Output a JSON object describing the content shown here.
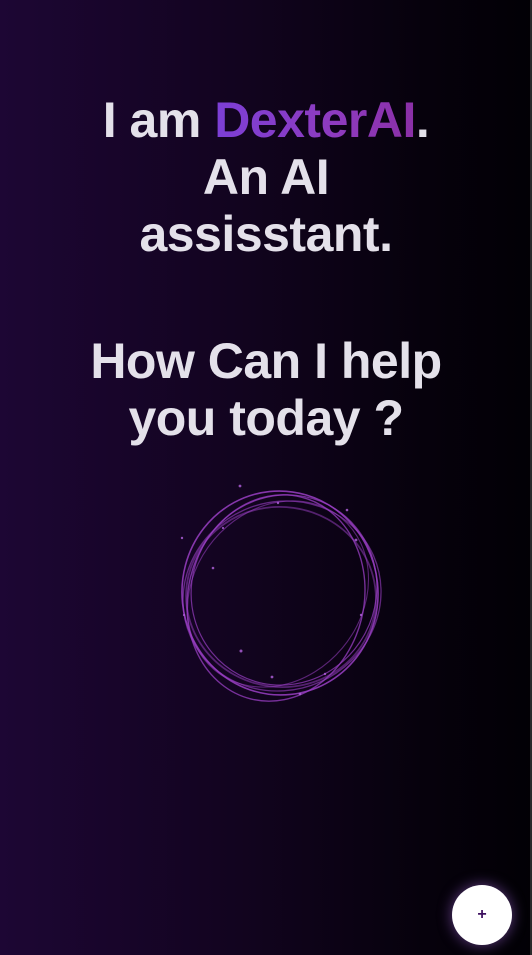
{
  "intro": {
    "prefix": "I am ",
    "brand": "DexterAI",
    "suffix": ".",
    "line2": "An AI",
    "line3": "assisstant."
  },
  "question": {
    "line1": "How Can I help",
    "line2": "you today ?"
  },
  "fab": {
    "label": "+"
  },
  "colors": {
    "background_left": "#1d0634",
    "background_right": "#020005",
    "text": "#e4e1ea",
    "brand_gradient_start": "#7c3fd6",
    "brand_gradient_end": "#8a2fa6",
    "orb_stroke": "#9a3fc4",
    "fab_background": "#ffffff"
  },
  "icons": {
    "orb": "voice-orb-icon",
    "fab": "plus-icon"
  }
}
